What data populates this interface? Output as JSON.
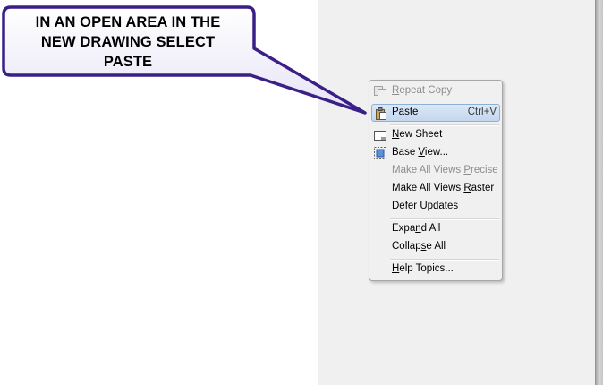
{
  "callout": {
    "lines": [
      "IN AN OPEN AREA IN THE",
      "NEW DRAWING SELECT",
      "PASTE"
    ]
  },
  "context_menu": {
    "items": [
      {
        "label": "Repeat Copy",
        "mnemonic": "R",
        "disabled": true,
        "icon": "repeat-copy-icon"
      },
      {
        "label": "Paste",
        "shortcut": "Ctrl+V",
        "highlighted": true,
        "icon": "paste-icon"
      },
      {
        "label": "New Sheet",
        "mnemonic": "N",
        "icon": "new-sheet-icon"
      },
      {
        "label": "Base View...",
        "mnemonic": "V",
        "icon": "base-view-icon"
      },
      {
        "label": "Make All Views Precise",
        "mnemonic": "P",
        "disabled": true
      },
      {
        "label": "Make All Views Raster",
        "mnemonic": "R"
      },
      {
        "label": "Defer Updates"
      },
      {
        "label": "Expand All",
        "mnemonic": "n"
      },
      {
        "label": "Collapse All",
        "mnemonic": "s"
      },
      {
        "label": "Help Topics...",
        "mnemonic": "H"
      }
    ]
  },
  "colors": {
    "callout_fill": "#f3f1fb",
    "callout_border": "#3a1f86",
    "menu_highlight": "#c9dcf2"
  }
}
